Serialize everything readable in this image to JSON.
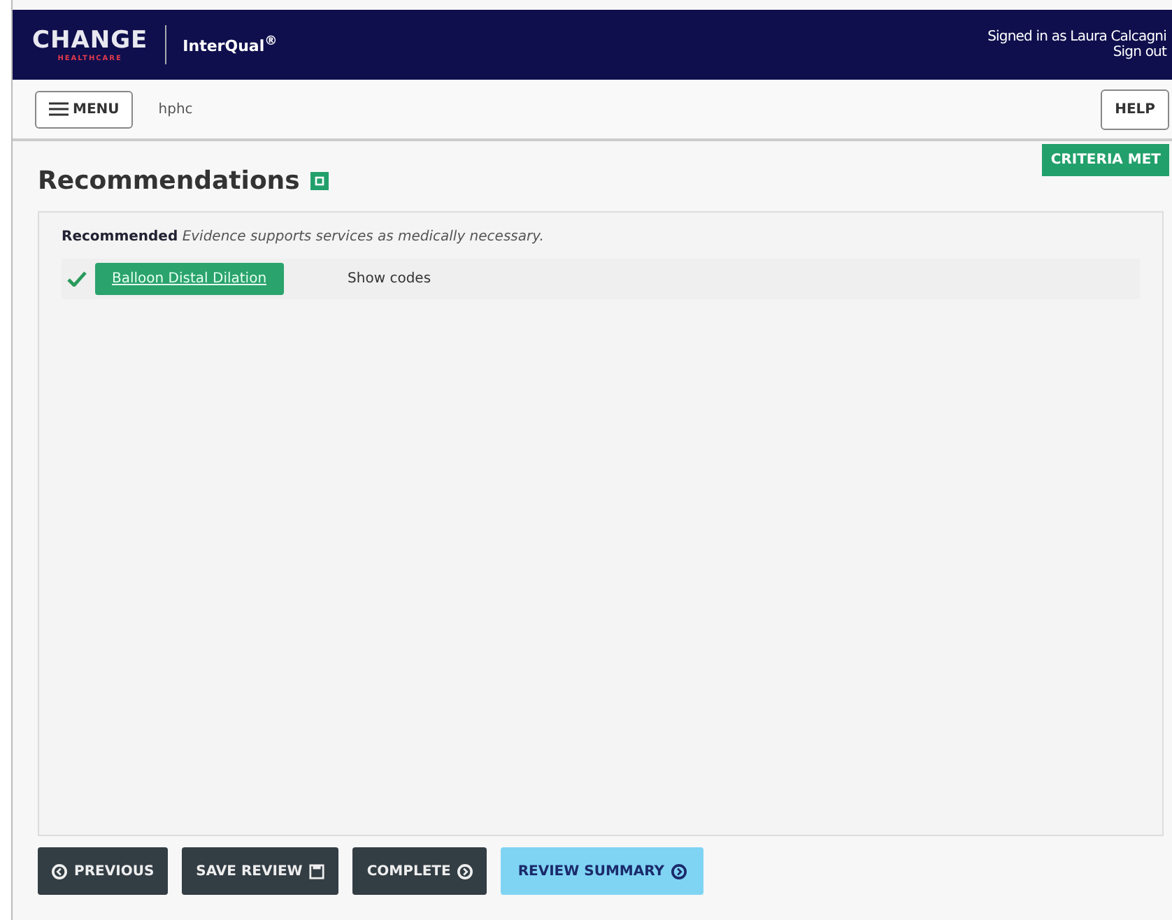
{
  "header": {
    "brand": "CHANGE",
    "brand_sub": "HEALTHCARE",
    "product": "InterQual$^{®}$",
    "signed_in": "Signed in as Laura Calcagni",
    "sign_out": "Sign out"
  },
  "toolbar": {
    "menu": "MENU",
    "context": "hphc",
    "help": "HELP"
  },
  "status_badge": "CRITERIA MET",
  "title": "Recommendations",
  "recommendation": {
    "text": "**Recommended** *Evidence supports services as medically necessary.*",
    "items": [
      {
        "label": "Balloon Distal Dilation",
        "checked": true,
        "codes_link": "Show codes"
      }
    ]
  },
  "buttons": [
    {
      "label": "PREVIOUS",
      "kind": "prev",
      "selected": false
    },
    {
      "label": "SAVE REVIEW",
      "kind": "save",
      "selected": false
    },
    {
      "label": "COMPLETE",
      "kind": "next",
      "selected": false
    },
    {
      "label": "REVIEW SUMMARY",
      "kind": "next",
      "selected": true
    }
  ]
}
